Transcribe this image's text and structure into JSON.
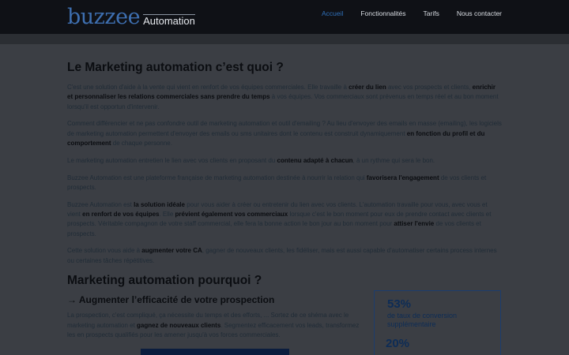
{
  "header": {
    "logo_main": "buzzee",
    "logo_sub": "Automation",
    "nav": [
      "Accueil",
      "Fonctionnalités",
      "Tarifs",
      "Nous contacter"
    ]
  },
  "section1": {
    "title": "Le Marketing automation c’est quoi ?",
    "p1": [
      {
        "t": "C'est une solution d'aide à la vente qui vient en renfort de vos équipes commerciales. Elle travaille à ",
        "b": false
      },
      {
        "t": "créer du lien",
        "b": true
      },
      {
        "t": " avec vos prospects et clients, ",
        "b": false
      },
      {
        "t": "enrichir et personnaliser les relations commerciales sans prendre du temps",
        "b": true
      },
      {
        "t": " à vos équipes. Vos commerciaux sont prévenus en temps réel et au bon moment lorsqu'il est opportun d'intervenir.",
        "b": false
      }
    ],
    "p2": [
      {
        "t": "Comment différencier et ne pas confondre outil de marketing automation et outil d'emailing ? Au lieu d'envoyer des emails en masse (emailing), les logiciels de marketing automation permettent d'envoyer des emails ou sms unitaires dont le contenu est construit dynamiquement ",
        "b": false
      },
      {
        "t": "en fonction du profil et du comportement",
        "b": true
      },
      {
        "t": " de chaque personne.",
        "b": false
      }
    ],
    "p3": [
      {
        "t": "Le marketing automation entretien le lien avec vos clients en proposant du ",
        "b": false
      },
      {
        "t": "contenu adapté à chacun",
        "b": true
      },
      {
        "t": ", à un rythme qui sera le bon.",
        "b": false
      }
    ],
    "p4": [
      {
        "t": "Buzzee Automation est une plateforme française de marketing automation destinée à nourrir la relation qui ",
        "b": false
      },
      {
        "t": "favorisera l'engagement",
        "b": true
      },
      {
        "t": " de vos clients et prospects.",
        "b": false
      }
    ],
    "p5": [
      {
        "t": "Buzzee Automation est ",
        "b": false
      },
      {
        "t": "la solution idéale",
        "b": true
      },
      {
        "t": " pour vous aider à créer ou entretenir du lien avec vos clients. L'automation travaille pour vous, avec vous et vient ",
        "b": false
      },
      {
        "t": "en renfort de vos équipes",
        "b": true
      },
      {
        "t": ". Elle ",
        "b": false
      },
      {
        "t": "prévient également vos commerciaux",
        "b": true
      },
      {
        "t": " lorsque c'est le bon moment pour eux de prendre contact avec clients et prospects. Véritable compagnon de votre staff commercial, elle fera la bonne action le bon jour au bon moment pour ",
        "b": false
      },
      {
        "t": "attiser l'envie",
        "b": true
      },
      {
        "t": " de vos clients et prospects.",
        "b": false
      }
    ],
    "p6": [
      {
        "t": "Cette solution vous aide à ",
        "b": false
      },
      {
        "t": "augmenter votre CA",
        "b": true
      },
      {
        "t": ", gagner de nouveaux clients, les fidéliser, mais est aussi capable d'automatiser certains process internes ou certaines tâches répétitives.",
        "b": false
      }
    ]
  },
  "section2": {
    "title": "Marketing automation pourquoi ?",
    "subtitle": "→ Augmenter l’efficacité de votre prospection",
    "p1": [
      {
        "t": "La prospection, c'est compliqué, ça nécessite du temps et des efforts, ... Sortez de ce shéma avec le marketing automation et ",
        "b": false
      },
      {
        "t": "gagnez de nouveaux clients",
        "b": true
      },
      {
        "t": ". Segmentez efficacement vos leads, transformez les en prospects qualifiés pour les amener jusqu'à vos forces commerciales.",
        "b": false
      }
    ],
    "stats": [
      {
        "value": "53%",
        "label": "de taux de conversion supplémentaire"
      },
      {
        "value": "20%",
        "label": ""
      }
    ]
  },
  "colors": {
    "header_bg": "#0f1116",
    "accent": "#2f6fb8",
    "stat_color": "#0d2c56"
  }
}
